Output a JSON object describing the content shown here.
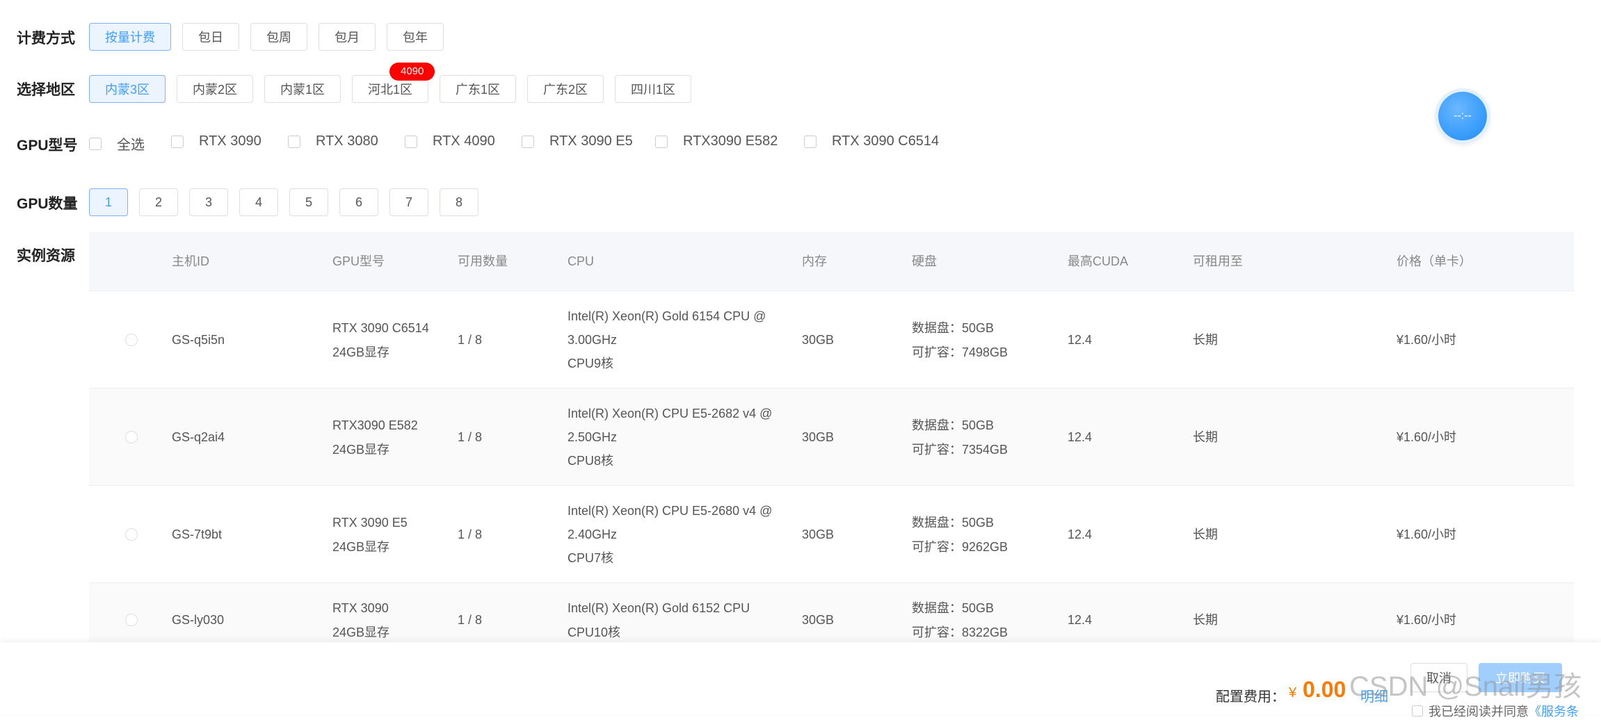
{
  "billing": {
    "label": "计费方式",
    "options": [
      "按量计费",
      "包日",
      "包周",
      "包月",
      "包年"
    ]
  },
  "region": {
    "label": "选择地区",
    "options": [
      "内蒙3区",
      "内蒙2区",
      "内蒙1区",
      "河北1区",
      "广东1区",
      "广东2区",
      "四川1区"
    ],
    "badge": "4090"
  },
  "gpu_model": {
    "label": "GPU型号",
    "options": [
      "全选",
      "RTX 3090",
      "RTX 3080",
      "RTX 4090",
      "RTX 3090 E5",
      "RTX3090 E582",
      "RTX 3090 C6514"
    ]
  },
  "gpu_count": {
    "label": "GPU数量",
    "options": [
      "1",
      "2",
      "3",
      "4",
      "5",
      "6",
      "7",
      "8"
    ]
  },
  "instances": {
    "label": "实例资源",
    "headers": [
      "主机ID",
      "GPU型号",
      "可用数量",
      "CPU",
      "内存",
      "硬盘",
      "最高CUDA",
      "可租用至",
      "价格（单卡）"
    ],
    "rows": [
      {
        "id": "GS-q5i5n",
        "gpu": "RTX 3090 C6514",
        "vram": "24GB显存",
        "avail": "1 / 8",
        "cpu1": "Intel(R) Xeon(R) Gold 6154 CPU @",
        "cpu2": "3.00GHz",
        "cpu3": "CPU9核",
        "mem": "30GB",
        "disk1": "数据盘：50GB",
        "disk2": "可扩容：7498GB",
        "cuda": "12.4",
        "until": "长期",
        "price": "¥1.60/小时"
      },
      {
        "id": "GS-q2ai4",
        "gpu": "RTX3090 E582",
        "vram": "24GB显存",
        "avail": "1 / 8",
        "cpu1": "Intel(R) Xeon(R) CPU E5-2682 v4 @",
        "cpu2": "2.50GHz",
        "cpu3": "CPU8核",
        "mem": "30GB",
        "disk1": "数据盘：50GB",
        "disk2": "可扩容：7354GB",
        "cuda": "12.4",
        "until": "长期",
        "price": "¥1.60/小时"
      },
      {
        "id": "GS-7t9bt",
        "gpu": "RTX 3090 E5",
        "vram": "24GB显存",
        "avail": "1 / 8",
        "cpu1": "Intel(R) Xeon(R) CPU E5-2680 v4 @",
        "cpu2": "2.40GHz",
        "cpu3": "CPU7核",
        "mem": "30GB",
        "disk1": "数据盘：50GB",
        "disk2": "可扩容：9262GB",
        "cuda": "12.4",
        "until": "长期",
        "price": "¥1.60/小时"
      },
      {
        "id": "GS-ly030",
        "gpu": "RTX 3090",
        "vram": "24GB显存",
        "avail": "1 / 8",
        "cpu1": "Intel(R) Xeon(R) Gold 6152 CPU",
        "cpu2": "CPU10核",
        "mem": "30GB",
        "disk1": "数据盘：50GB",
        "disk2": "可扩容：8322GB",
        "cuda": "12.4",
        "until": "长期",
        "price": "¥1.60/小时"
      }
    ]
  },
  "footer": {
    "cost_label": "配置费用：",
    "currency": "¥",
    "amount": "0.00",
    "detail_link": "明细",
    "cancel": "取消",
    "buy": "立即购买",
    "agree_text": "我已经阅读并同意",
    "terms_link": "《服务条"
  },
  "floating": {
    "label": "--:--"
  },
  "watermark": "CSDN @Snail男孩",
  "colors": {
    "accent": "#409eff",
    "price": "#ff7a00",
    "badge": "#ff0000"
  }
}
